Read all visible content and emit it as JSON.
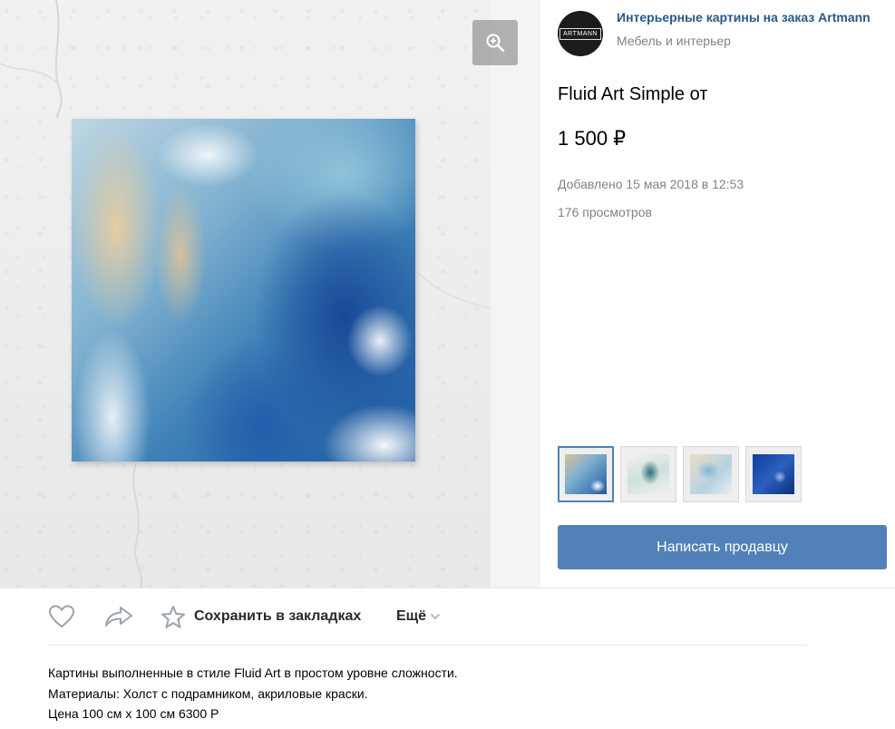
{
  "shop": {
    "name": "Интерьерные картины на заказ Artmann",
    "category": "Мебель и интерьер",
    "logo_text": "ARTMANN"
  },
  "product": {
    "title": "Fluid Art Simple от",
    "price": "1 500 ₽",
    "added": "Добавлено 15 мая 2018 в 12:53",
    "views": "176 просмотров"
  },
  "buttons": {
    "contact_label": "Написать продавцу",
    "save_label": "Сохранить в закладках",
    "more_label": "Ещё"
  },
  "icons": {
    "zoom": "zoom-in-icon",
    "like": "heart-icon",
    "share": "share-arrow-icon",
    "save": "star-icon",
    "more": "chevron-down-icon"
  },
  "thumbnails": {
    "count": 4,
    "selected_index": 0
  },
  "description": {
    "line1": "Картины выполненные в стиле Fluid Art в простом уровне сложности.",
    "line2": "Материалы: Холст с подрамником, акриловые краски.",
    "line3": "Цена 100 см х 100 см 6300 Р"
  },
  "colors": {
    "accent": "#5181b8",
    "link": "#2a5885",
    "muted": "#828282"
  }
}
